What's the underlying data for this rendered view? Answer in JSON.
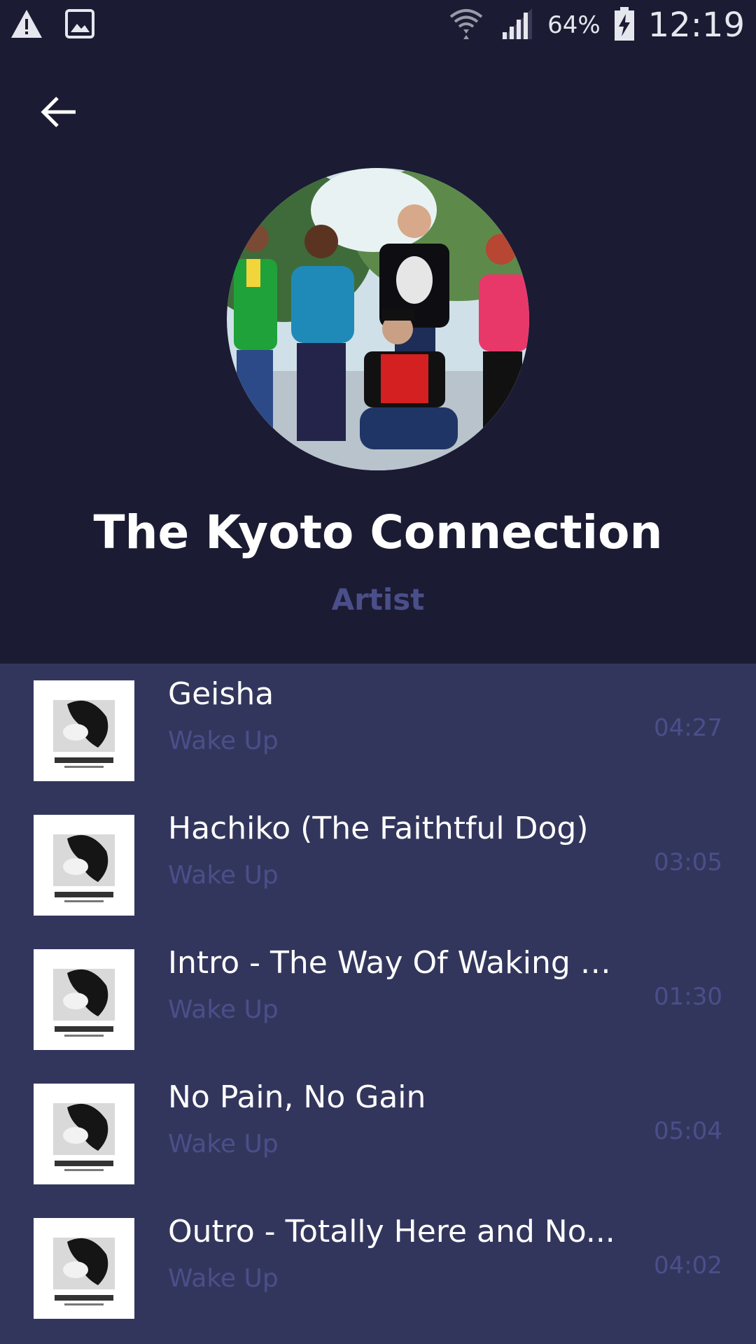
{
  "status_bar": {
    "battery_percent": "64%",
    "time": "12:19",
    "icons": [
      "warning-icon",
      "image-icon",
      "wifi-icon",
      "signal-icon",
      "battery-charging-icon"
    ]
  },
  "header": {
    "back_icon": "back-arrow-icon",
    "artist_name": "The Kyoto Connection",
    "subtitle": "Artist"
  },
  "tracks": [
    {
      "title": "Geisha",
      "album": "Wake Up",
      "duration": "04:27"
    },
    {
      "title": "Hachiko (The Faithtful Dog)",
      "album": "Wake Up",
      "duration": "03:05"
    },
    {
      "title": "Intro - The Way Of Waking U...",
      "album": "Wake Up",
      "duration": "01:30"
    },
    {
      "title": "No Pain, No Gain",
      "album": "Wake Up",
      "duration": "05:04"
    },
    {
      "title": "Outro - Totally Here and No...",
      "album": "Wake Up",
      "duration": "04:02"
    }
  ],
  "colors": {
    "background": "#1b1b33",
    "list_background": "#33365c",
    "accent": "#4a4f8a",
    "text": "#ffffff"
  }
}
